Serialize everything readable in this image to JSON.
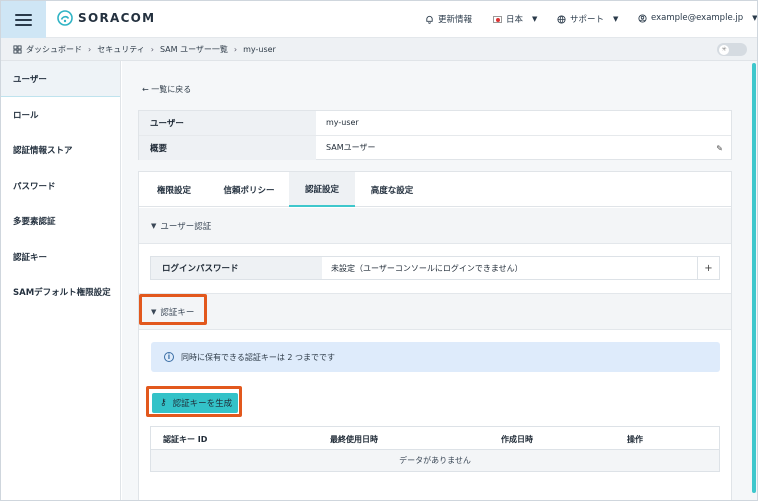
{
  "header": {
    "brand": "SORACOM",
    "updates": "更新情報",
    "language": "日本",
    "support": "サポート",
    "account": "example@example.jp"
  },
  "breadcrumb": [
    "ダッシュボード",
    "セキュリティ",
    "SAM ユーザー一覧",
    "my-user"
  ],
  "sidebar": {
    "items": [
      {
        "label": "ユーザー"
      },
      {
        "label": "ロール"
      },
      {
        "label": "認証情報ストア"
      },
      {
        "label": "パスワード"
      },
      {
        "label": "多要素認証"
      },
      {
        "label": "認証キー"
      },
      {
        "label": "SAMデフォルト権限設定"
      }
    ]
  },
  "main": {
    "back": "一覧に戻る",
    "info": {
      "user_label": "ユーザー",
      "user_value": "my-user",
      "desc_label": "概要",
      "desc_value": "SAMユーザー"
    },
    "tabs": [
      {
        "label": "権限設定"
      },
      {
        "label": "信頼ポリシー"
      },
      {
        "label": "認証設定"
      },
      {
        "label": "高度な設定"
      }
    ],
    "user_auth": {
      "title": "ユーザー認証",
      "login_label": "ログインパスワード",
      "login_value": "未設定（ユーザーコンソールにログインできません）"
    },
    "auth_key": {
      "title": "認証キー",
      "notice": "同時に保有できる認証キーは 2 つまでです",
      "generate_button": "認証キーを生成",
      "columns": [
        "認証キー ID",
        "最終使用日時",
        "作成日時",
        "操作"
      ],
      "empty": "データがありません"
    }
  },
  "colors": {
    "accent": "#33c2c8",
    "highlight": "#e2581d",
    "notice_bg": "#deebfb"
  }
}
